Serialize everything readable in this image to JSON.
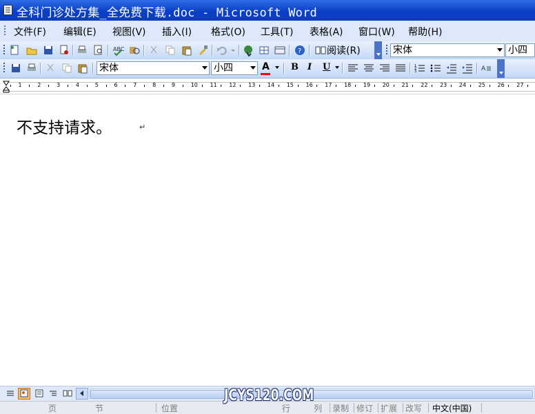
{
  "window": {
    "title": "全科门诊处方集_全免费下载.doc - Microsoft Word"
  },
  "menu": [
    "文件(F)",
    "编辑(E)",
    "视图(V)",
    "插入(I)",
    "格式(O)",
    "工具(T)",
    "表格(A)",
    "窗口(W)",
    "帮助(H)"
  ],
  "standard_toolbar": {
    "read_label": "阅读(R)",
    "font": "宋体",
    "size": "小四"
  },
  "formatting_toolbar": {
    "font": "宋体",
    "size": "小四",
    "bold": "B",
    "italic": "I",
    "underline": "U",
    "font_color": "A"
  },
  "ruler": {
    "numbers": [
      "1",
      "2",
      "3",
      "4",
      "5",
      "6",
      "7",
      "8",
      "9",
      "10",
      "11",
      "12",
      "13",
      "14",
      "15",
      "16",
      "17",
      "18",
      "19",
      "20",
      "21",
      "22",
      "23",
      "24",
      "25",
      "26",
      "27"
    ]
  },
  "document": {
    "body_text": "不支持请求。",
    "paragraph_mark": "↵"
  },
  "statusbar": {
    "page": "页",
    "section": "节",
    "position": "位置",
    "line": "行",
    "column": "列",
    "record": "录制",
    "track": "修订",
    "extend": "扩展",
    "overtype": "改写",
    "language": "中文(中国)"
  },
  "watermark": "JCYS120.COM",
  "colors": {
    "titlebar": "#0a3fc6",
    "menubar": "#dde9fb",
    "font_color_underline": "#e01010"
  }
}
